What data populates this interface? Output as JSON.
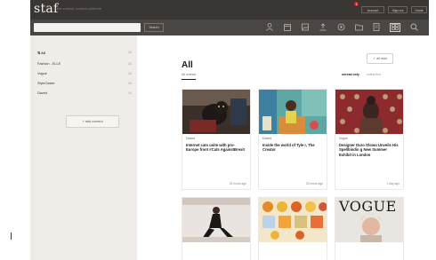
{
  "app": {
    "logo": "staf",
    "tagline": "the content curation platform",
    "notification_count": "1",
    "buttons": [
      "Account",
      "Sign out",
      "Guide"
    ]
  },
  "search": {
    "placeholder": "",
    "button_label": "Search"
  },
  "toolbar": {
    "icons": [
      "person-icon",
      "calendar-icon",
      "image-icon",
      "upload-icon",
      "settings-icon",
      "folder-icon",
      "document-icon",
      "grid-icon",
      "search-icon"
    ],
    "active_icon": "grid-icon"
  },
  "sidebar": {
    "items": [
      {
        "label": "All",
        "count": "10"
      },
      {
        "label": "Fashion - ELLE",
        "count": "10"
      },
      {
        "label": "Vogue",
        "count": "10"
      },
      {
        "label": "StyleCaster",
        "count": "10"
      },
      {
        "label": "Dazed",
        "count": "10"
      }
    ],
    "add_content_label": "+ add content"
  },
  "main": {
    "title": "All",
    "subtitle": "All unread",
    "all_read_label": "✓ all read",
    "filter_unread": "unread only",
    "filter_oldest": "oldest first"
  },
  "cards": [
    {
      "source": "Dazed",
      "title": "Internet cats unite with pro-Europe front #Cats AgainstBrexit",
      "time": "32 hours ago"
    },
    {
      "source": "Dazed",
      "title": "Inside the world of Tyle r, The Creator",
      "time": "32 hours ago"
    },
    {
      "source": "Vogue",
      "title": "Designer Duro Olowu Unveils His Spellbindin g New Summer Exhibit in London",
      "time": "1 day ago"
    },
    {
      "source": "",
      "title": "",
      "time": ""
    },
    {
      "source": "",
      "title": "",
      "time": ""
    },
    {
      "source": "",
      "title": "VOGUE",
      "time": ""
    }
  ],
  "colors": {
    "topbar": "#3a3634",
    "sidebar": "#f0ede9",
    "accent_badge": "#d2232a"
  }
}
